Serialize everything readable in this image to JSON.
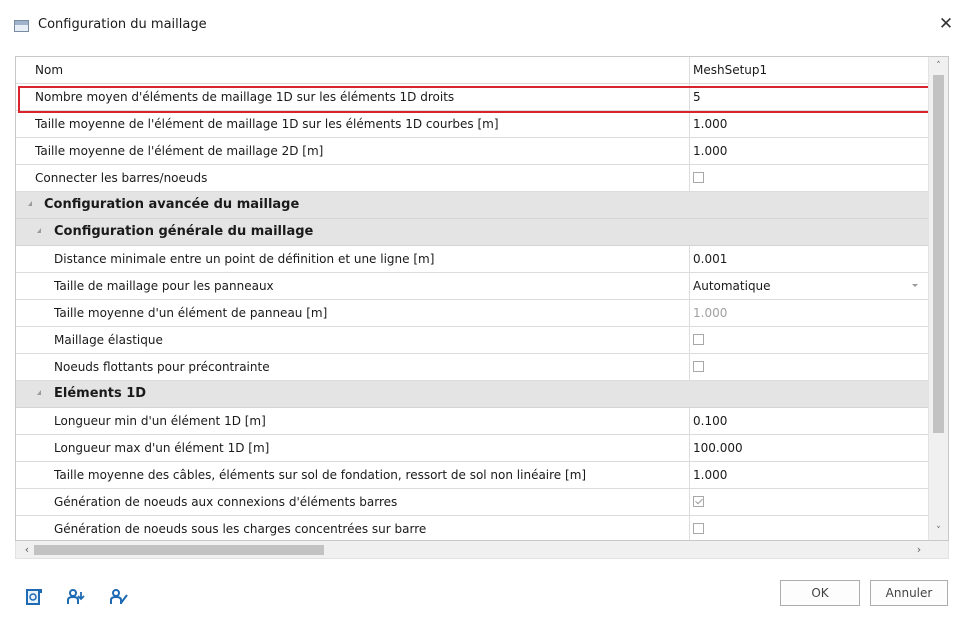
{
  "window": {
    "title": "Configuration du maillage",
    "close_glyph": "✕"
  },
  "grid": {
    "header": {
      "name": "Nom",
      "value": "MeshSetup1"
    },
    "rows": [
      {
        "name": "Nombre moyen d'éléments de maillage 1D sur les éléments 1D droits",
        "value": "5"
      },
      {
        "name": "Taille moyenne de l'élément de maillage 1D sur les éléments 1D courbes [m]",
        "value": "1.000"
      },
      {
        "name": "Taille moyenne de l'élément de maillage 2D [m]",
        "value": "1.000"
      },
      {
        "name": "Connecter les barres/noeuds",
        "checked": false
      },
      {
        "name": "Configuration avancée du maillage"
      },
      {
        "name": "Configuration générale du maillage"
      },
      {
        "name": "Distance minimale entre un point de définition et une ligne [m]",
        "value": "0.001"
      },
      {
        "name": "Taille de maillage pour les panneaux",
        "value": "Automatique"
      },
      {
        "name": "Taille moyenne d'un élément de panneau [m]",
        "value": "1.000"
      },
      {
        "name": "Maillage élastique",
        "checked": false
      },
      {
        "name": "Noeuds flottants pour précontrainte",
        "checked": false
      },
      {
        "name": "Eléments 1D"
      },
      {
        "name": "Longueur min d'un élément 1D [m]",
        "value": "0.100"
      },
      {
        "name": "Longueur max d'un élément 1D [m]",
        "value": "100.000"
      },
      {
        "name": "Taille moyenne des câbles, éléments sur sol de fondation, ressort de sol non linéaire [m]",
        "value": "1.000"
      },
      {
        "name": "Génération de noeuds aux connexions d'éléments barres",
        "checked": true
      },
      {
        "name": "Génération de noeuds sous les charges concentrées sur barre",
        "checked": false
      }
    ]
  },
  "scroll": {
    "up": "˄",
    "down": "˅",
    "left": "‹",
    "right": "›"
  },
  "icons": {
    "tool1": "document-info-icon",
    "tool2": "user-add-icon",
    "tool3": "user-edit-icon"
  },
  "footer": {
    "ok_label": "OK",
    "cancel_label": "Annuler"
  }
}
